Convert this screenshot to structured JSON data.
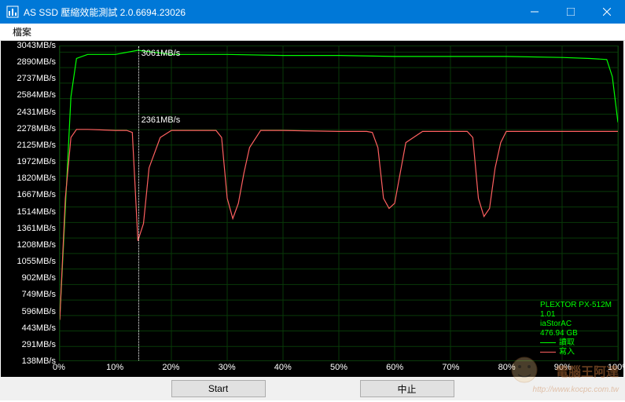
{
  "window": {
    "title": "AS SSD 壓縮效能測試 2.0.6694.23026",
    "menu_file": "檔案"
  },
  "buttons": {
    "start": "Start",
    "stop": "中止"
  },
  "info": {
    "device": "PLEXTOR PX-512M",
    "version": "1.01",
    "driver": "iaStorAC",
    "capacity": "476.94 GB",
    "legend_read": "讀取",
    "legend_write": "寫入"
  },
  "markers": {
    "read_label": "3061MB/s",
    "write_label": "2361MB/s",
    "x_position_pct": 14
  },
  "chart_data": {
    "type": "line",
    "xlabel": "",
    "ylabel": "",
    "x_ticks": [
      "0%",
      "10%",
      "20%",
      "30%",
      "40%",
      "50%",
      "60%",
      "70%",
      "80%",
      "90%",
      "100%"
    ],
    "y_ticks": [
      "138MB/s",
      "291MB/s",
      "443MB/s",
      "596MB/s",
      "749MB/s",
      "902MB/s",
      "1055MB/s",
      "1208MB/s",
      "1361MB/s",
      "1514MB/s",
      "1667MB/s",
      "1820MB/s",
      "1972MB/s",
      "2125MB/s",
      "2278MB/s",
      "2431MB/s",
      "2584MB/s",
      "2737MB/s",
      "2890MB/s",
      "3043MB/s"
    ],
    "ylim": [
      0,
      3100
    ],
    "series": [
      {
        "name": "讀取",
        "color": "#00ff00",
        "x": [
          0,
          1,
          2,
          3,
          5,
          10,
          14,
          20,
          30,
          40,
          50,
          60,
          70,
          80,
          90,
          95,
          98,
          99,
          100
        ],
        "values": [
          400,
          1500,
          2600,
          2980,
          3020,
          3020,
          3061,
          3020,
          3020,
          3010,
          3010,
          3000,
          3000,
          3000,
          2990,
          2980,
          2970,
          2800,
          2350
        ]
      },
      {
        "name": "寫入",
        "color": "#ff6060",
        "x": [
          0,
          1,
          2,
          3,
          5,
          10,
          12,
          13,
          14,
          15,
          16,
          18,
          20,
          25,
          28,
          29,
          30,
          31,
          32,
          33,
          34,
          36,
          40,
          50,
          55,
          56,
          57,
          58,
          59,
          60,
          61,
          62,
          65,
          70,
          73,
          74,
          75,
          76,
          77,
          78,
          79,
          80,
          85,
          90,
          95,
          100
        ],
        "values": [
          400,
          1600,
          2200,
          2280,
          2280,
          2270,
          2270,
          2250,
          1180,
          1350,
          1900,
          2200,
          2270,
          2270,
          2270,
          2200,
          1600,
          1400,
          1550,
          1850,
          2100,
          2270,
          2270,
          2260,
          2260,
          2250,
          2100,
          1600,
          1500,
          1550,
          1850,
          2150,
          2260,
          2260,
          2260,
          2200,
          1600,
          1420,
          1500,
          1900,
          2150,
          2260,
          2260,
          2260,
          2260,
          2260
        ]
      }
    ]
  },
  "colors": {
    "titlebar": "#0078d7",
    "chart_bg": "#000000",
    "grid": "#083a08",
    "read": "#00ff00",
    "write": "#ff6060"
  }
}
